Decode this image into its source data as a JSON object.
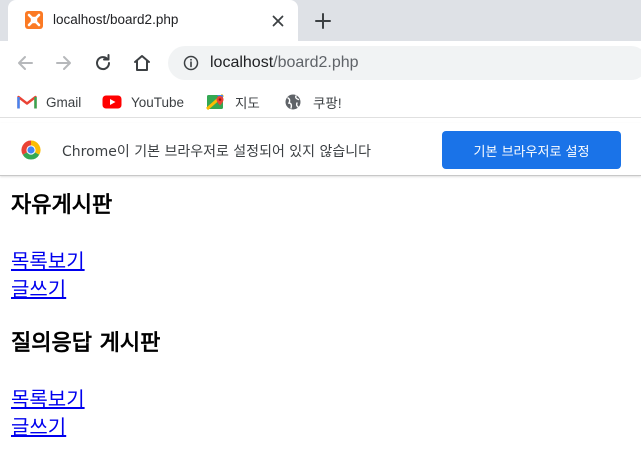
{
  "browser": {
    "tab": {
      "title": "localhost/board2.php"
    },
    "address_bar": {
      "host": "localhost",
      "path": "/board2.php"
    },
    "bookmarks": [
      {
        "label": "Gmail",
        "icon": "gmail-icon"
      },
      {
        "label": "YouTube",
        "icon": "youtube-icon"
      },
      {
        "label": "지도",
        "icon": "maps-icon"
      },
      {
        "label": "쿠팡!",
        "icon": "globe-icon"
      }
    ],
    "infobar": {
      "message": "Chrome이 기본 브라우저로 설정되어 있지 않습니다",
      "button_label": "기본 브라우저로 설정"
    }
  },
  "page": {
    "sections": [
      {
        "heading": "자유게시판",
        "links": [
          "목록보기",
          "글쓰기"
        ]
      },
      {
        "heading": "질의응답 게시판",
        "links": [
          "목록보기",
          "글쓰기"
        ]
      }
    ]
  },
  "colors": {
    "tabstrip_bg": "#dee1e6",
    "accent_button": "#1a73e8",
    "link": "#0000ee",
    "xampp_orange": "#fb7a24"
  }
}
